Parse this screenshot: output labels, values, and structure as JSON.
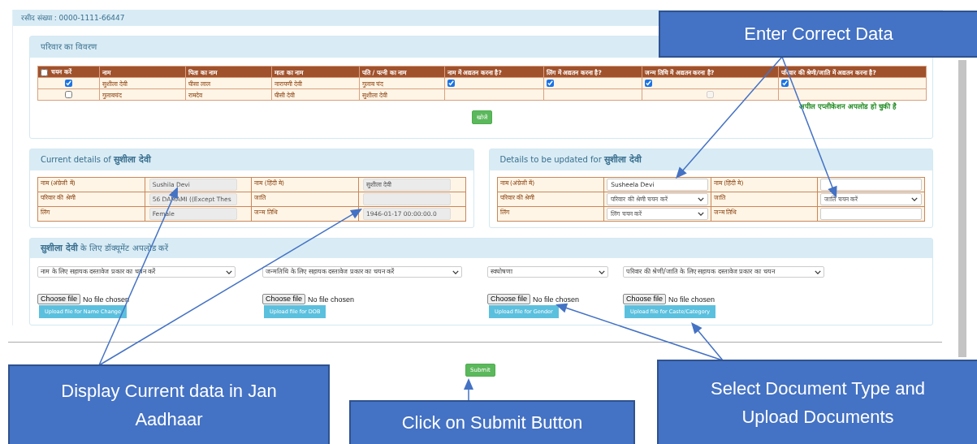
{
  "receipt": "रसीद संख्या : 0000-1111-66447",
  "family": {
    "title": "परिवार का विवरण",
    "columns": [
      "चयन करें",
      "नाम",
      "पिता का नाम",
      "माता का नाम",
      "पति / पत्नी का नाम",
      "नाम में अद्यतन करना है?",
      "लिंग में अद्यतन करना है?",
      "जन्म तिथि में अद्यतन करना है?",
      "परिवार की श्रेणी/जाति में अद्यतन करना है?"
    ],
    "select_all": {
      "checked": false
    },
    "rows": [
      {
        "cells": [
          {
            "kind": "checkbox",
            "checked": true,
            "disabled": false
          },
          {
            "kind": "text",
            "text": "सुशीला देवी"
          },
          {
            "kind": "text",
            "text": "घीसा लाल"
          },
          {
            "kind": "text",
            "text": "नारायणी देवी"
          },
          {
            "kind": "text",
            "text": "गुलाब चंद"
          },
          {
            "kind": "checkbox",
            "checked": true,
            "disabled": false
          },
          {
            "kind": "checkbox",
            "checked": true,
            "disabled": false
          },
          {
            "kind": "checkbox",
            "checked": true,
            "disabled": false
          },
          {
            "kind": "checkbox",
            "checked": true,
            "disabled": false
          }
        ]
      },
      {
        "cells": [
          {
            "kind": "checkbox",
            "checked": false,
            "disabled": false
          },
          {
            "kind": "text",
            "text": "गुलाबचंद"
          },
          {
            "kind": "text",
            "text": "रामदेव"
          },
          {
            "kind": "text",
            "text": "घीसी देवी"
          },
          {
            "kind": "text",
            "text": "सुशीला देवी"
          },
          {
            "kind": "none"
          },
          {
            "kind": "none"
          },
          {
            "kind": "checkbox",
            "checked": false,
            "disabled": true
          },
          {
            "kind": "none"
          }
        ]
      }
    ],
    "search_button": "खोजें",
    "message": "अपील एप्लीकेशन अपलोड हो चुकी है"
  },
  "current": {
    "title": "Current details of **सुशीला देवी**",
    "rows": [
      [
        {
          "label": "नाम (अंग्रेजी में)",
          "value": "Sushila Devi"
        },
        {
          "label": "नाम (हिंदी मे)",
          "value": "सुशीला देवी"
        }
      ],
      [
        {
          "label": "परिवार की श्रेणी",
          "value": "56 DAMAMI ((Except Thes"
        },
        {
          "label": "जाति"
        }
      ],
      [
        {
          "label": "लिंग",
          "value": "Female"
        },
        {
          "label": "जन्म तिथि",
          "value": "1946-01-17 00:00:00.0"
        }
      ]
    ]
  },
  "update": {
    "title": "Details to be updated for **सुशीला देवी**",
    "rows": [
      [
        {
          "label": "नाम (अंग्रेजी में)",
          "kind": "input",
          "value": "Susheela Devi"
        },
        {
          "label": "नाम (हिंदी मे)",
          "kind": "input"
        }
      ],
      [
        {
          "label": "परिवार की श्रेणी",
          "kind": "select",
          "value": "परिवार की श्रेणी चयन करें"
        },
        {
          "label": "जाति",
          "kind": "select",
          "value": "जाति चयन करें"
        }
      ],
      [
        {
          "label": "लिंग",
          "kind": "select",
          "value": "लिंग चयन करें"
        },
        {
          "label": "जन्म तिथि",
          "kind": "input"
        }
      ]
    ]
  },
  "documents": {
    "title": "**सुशीला देवी**    के लिए डॉक्यूमेंट अपलोड करें",
    "columns": [
      {
        "select": "नाम के लिए सहायक दस्तावेज प्रकार का चयन करें",
        "choose": "Choose file",
        "status": "No file chosen",
        "upload": "Upload file for Name Change"
      },
      {
        "select": "जन्मतिथि के लिए सहायक दस्तावेज प्रकार का चयन करें",
        "choose": "Choose file",
        "status": "No file chosen",
        "upload": "Upload file for DOB"
      },
      {
        "select": "स्वघोषणा",
        "choose": "Choose file",
        "status": "No file chosen",
        "upload": "Upload file for Gender"
      },
      {
        "select": "परिवार की श्रेणी/जाति के लिए सहायक दस्तावेज प्रकार का चयन",
        "choose": "Choose file",
        "status": "No file chosen",
        "upload": "Upload file for Caste/Category"
      }
    ]
  },
  "submit_button": "Submit",
  "callouts": [
    "Enter Correct Data",
    "Display Current data in Jan Aadhaar",
    "Click on Submit Button",
    "Select Document Type and Upload Documents"
  ]
}
